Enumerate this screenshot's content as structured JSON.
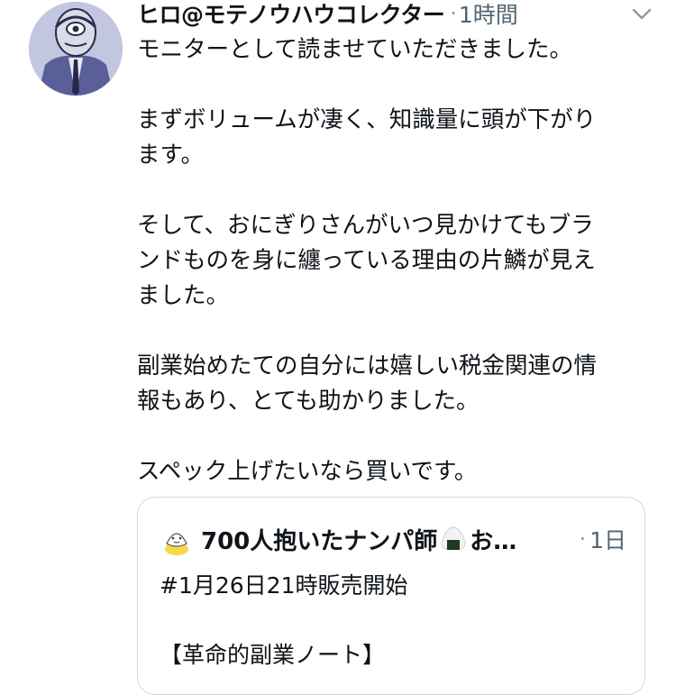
{
  "tweet": {
    "author_name": "ヒロ@モテノウハウコレクター",
    "separator": "·",
    "time": "1時間",
    "caret_icon": "chevron-down-icon",
    "lines": [
      "モニターとして読ませていただきました。",
      "",
      "まずボリュームが凄く、知識量に頭が下がり",
      "ます。",
      "",
      "そして、おにぎりさんがいつ見かけてもブラ",
      "ンドものを身に纏っている理由の片鱗が見え",
      "ました。",
      "",
      "副業始めたての自分には嬉しい税金関連の情",
      "報もあり、とても助かりました。",
      "",
      "スペック上げたいなら買いです。"
    ]
  },
  "quote": {
    "author_name": "700人抱いたナンパ師",
    "author_emoji": "onigiri-icon",
    "author_name_truncated": "お…",
    "separator": "·",
    "time": "1日",
    "lines": [
      "#1月26日21時販売開始",
      "",
      "【革命的副業ノート】"
    ]
  },
  "colors": {
    "text": "#0f1419",
    "secondary": "#536471",
    "border": "#cfd9de"
  }
}
